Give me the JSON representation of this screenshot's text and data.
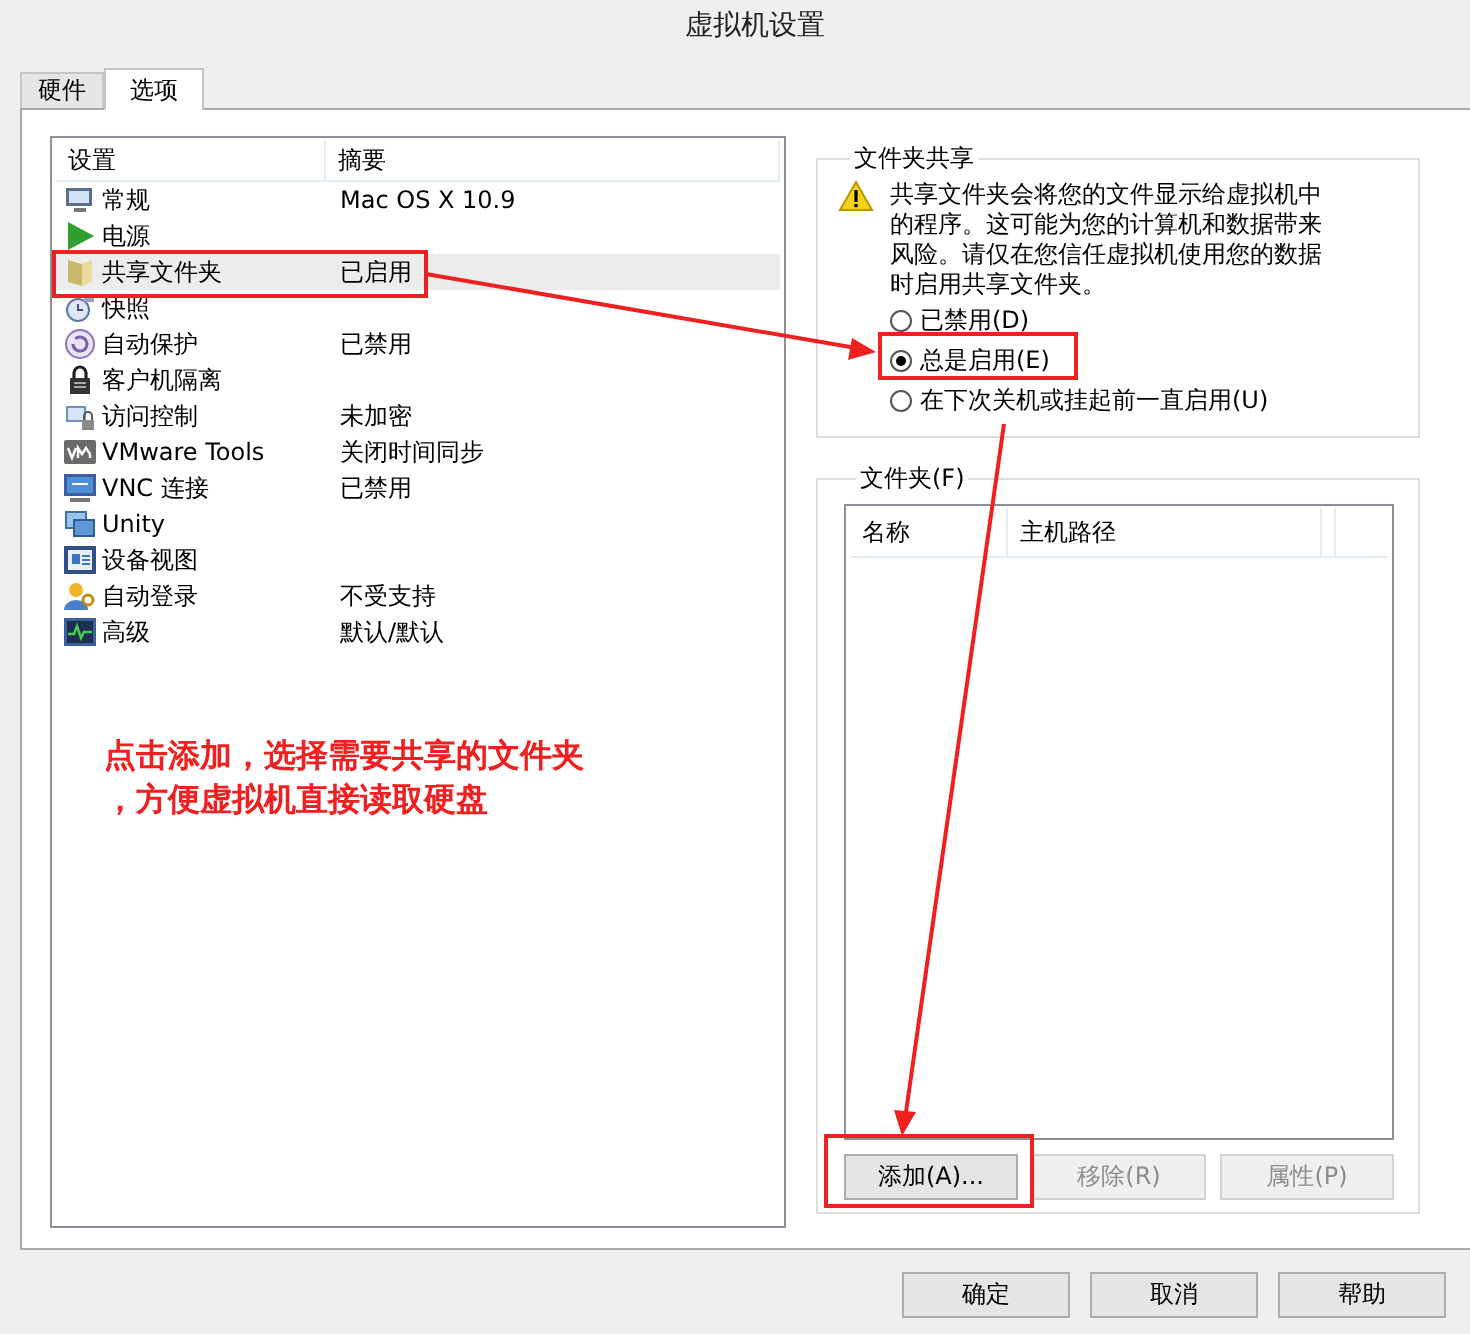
{
  "window": {
    "title": "虚拟机设置"
  },
  "tabs": [
    {
      "label": "硬件",
      "selected": false
    },
    {
      "label": "选项",
      "selected": true
    }
  ],
  "settings_list": {
    "columns": [
      "设置",
      "摘要"
    ],
    "rows": [
      {
        "name": "常规",
        "summary": "Mac OS X 10.9",
        "selected": false
      },
      {
        "name": "电源",
        "selected": false
      },
      {
        "name": "共享文件夹",
        "summary": "已启用",
        "selected": true
      },
      {
        "name": "快照",
        "selected": false
      },
      {
        "name": "自动保护",
        "summary": "已禁用",
        "selected": false
      },
      {
        "name": "客户机隔离",
        "selected": false
      },
      {
        "name": "访问控制",
        "summary": "未加密",
        "selected": false
      },
      {
        "name": "VMware Tools",
        "summary": "关闭时间同步",
        "selected": false
      },
      {
        "name": "VNC 连接",
        "summary": "已禁用",
        "selected": false
      },
      {
        "name": "Unity",
        "selected": false
      },
      {
        "name": "设备视图",
        "selected": false
      },
      {
        "name": "自动登录",
        "summary": "不受支持",
        "selected": false
      },
      {
        "name": "高级",
        "summary": "默认/默认",
        "selected": false
      }
    ]
  },
  "folder_sharing": {
    "title": "文件夹共享",
    "warning": "共享文件夹会将您的文件显示给虚拟机中的程序。这可能为您的计算机和数据带来风险。请仅在您信任虚拟机使用您的数据时启用共享文件夹。",
    "options": [
      {
        "label": "已禁用(D)",
        "selected": false
      },
      {
        "label": "总是启用(E)",
        "selected": true
      },
      {
        "label": "在下次关机或挂起前一直启用(U)",
        "selected": false
      }
    ]
  },
  "folders": {
    "title": "文件夹(F)",
    "columns": [
      "名称",
      "主机路径"
    ],
    "buttons": [
      {
        "label": "添加(A)...",
        "disabled": false
      },
      {
        "label": "移除(R)",
        "disabled": true
      },
      {
        "label": "属性(P)",
        "disabled": true
      }
    ]
  },
  "dialog_buttons": [
    {
      "label": "确定"
    },
    {
      "label": "取消"
    },
    {
      "label": "帮助"
    }
  ],
  "annotation": {
    "note_lines": [
      "点击添加，选择需要共享的文件夹",
      "，方便虚拟机直接读取硬盘"
    ]
  }
}
